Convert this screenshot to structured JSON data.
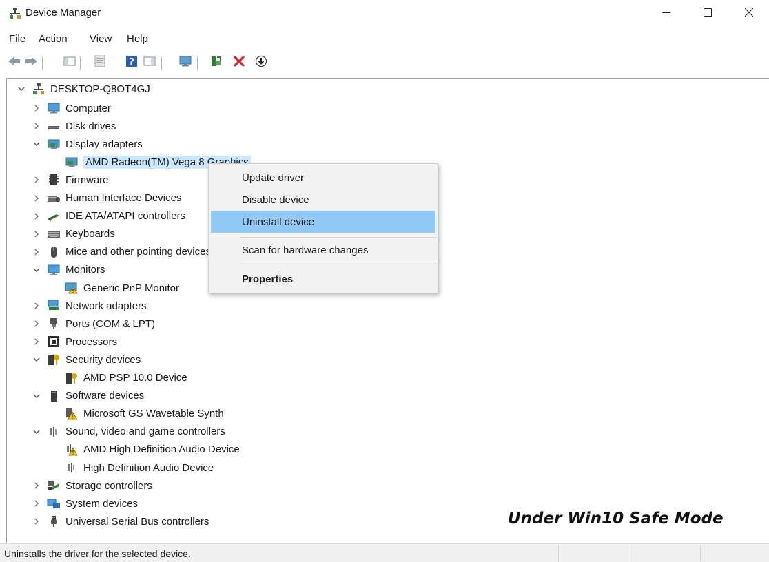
{
  "window": {
    "title": "Device Manager"
  },
  "menu": [
    "File",
    "Action",
    "View",
    "Help"
  ],
  "toolbar": {
    "buttons": [
      "back-arrow-icon",
      "forward-arrow-icon",
      "show-hide-console-tree-icon",
      "properties-icon",
      "help-icon",
      "show-action-pane-icon",
      "monitor-icon",
      "update-driver-icon",
      "uninstall-icon",
      "download-icon"
    ]
  },
  "tree": {
    "root": "DESKTOP-Q8OT4GJ",
    "items": [
      {
        "label": "Computer",
        "expanded": false,
        "icon": "computer-icon"
      },
      {
        "label": "Disk drives",
        "expanded": false,
        "icon": "disk-drive-icon"
      },
      {
        "label": "Display adapters",
        "expanded": true,
        "icon": "display-adapter-icon"
      },
      {
        "label": "AMD Radeon(TM) Vega 8 Graphics",
        "child": true,
        "icon": "display-adapter-icon",
        "selected": true
      },
      {
        "label": "Firmware",
        "expanded": false,
        "icon": "firmware-icon"
      },
      {
        "label": "Human Interface Devices",
        "expanded": false,
        "icon": "hid-icon"
      },
      {
        "label": "IDE ATA/ATAPI controllers",
        "expanded": false,
        "icon": "ide-controller-icon"
      },
      {
        "label": "Keyboards",
        "expanded": false,
        "icon": "keyboard-icon"
      },
      {
        "label": "Mice and other pointing devices",
        "expanded": false,
        "icon": "mouse-icon"
      },
      {
        "label": "Monitors",
        "expanded": true,
        "icon": "monitor-icon"
      },
      {
        "label": "Generic PnP Monitor",
        "child": true,
        "icon": "monitor-warning-icon"
      },
      {
        "label": "Network adapters",
        "expanded": false,
        "icon": "network-adapter-icon"
      },
      {
        "label": "Ports (COM & LPT)",
        "expanded": false,
        "icon": "port-icon"
      },
      {
        "label": "Processors",
        "expanded": false,
        "icon": "processor-icon"
      },
      {
        "label": "Security devices",
        "expanded": true,
        "icon": "security-device-icon"
      },
      {
        "label": "AMD PSP 10.0 Device",
        "child": true,
        "icon": "security-device-icon"
      },
      {
        "label": "Software devices",
        "expanded": true,
        "icon": "software-device-icon"
      },
      {
        "label": "Microsoft GS Wavetable Synth",
        "child": true,
        "icon": "software-device-warning-icon"
      },
      {
        "label": "Sound, video and game controllers",
        "expanded": true,
        "icon": "speaker-icon"
      },
      {
        "label": "AMD High Definition Audio Device",
        "child": true,
        "icon": "speaker-warning-icon"
      },
      {
        "label": "High Definition Audio Device",
        "child": true,
        "icon": "speaker-icon"
      },
      {
        "label": "Storage controllers",
        "expanded": false,
        "icon": "storage-controller-icon"
      },
      {
        "label": "System devices",
        "expanded": false,
        "icon": "system-device-icon"
      },
      {
        "label": "Universal Serial Bus controllers",
        "expanded": false,
        "icon": "usb-icon"
      }
    ]
  },
  "context_menu": {
    "items": [
      {
        "label": "Update driver"
      },
      {
        "label": "Disable device"
      },
      {
        "label": "Uninstall device",
        "highlighted": true
      },
      {
        "label": "Scan for hardware changes"
      },
      {
        "label": "Properties",
        "bold": true
      }
    ]
  },
  "status": "Uninstalls the driver for the selected device.",
  "annotation": "Under Win10 Safe Mode",
  "colors": {
    "selection": "#cce8ff",
    "menu_highlight": "#91c9f7",
    "uninstall_red": "#d9261c",
    "monitor_blue": "#1e8fd6"
  }
}
